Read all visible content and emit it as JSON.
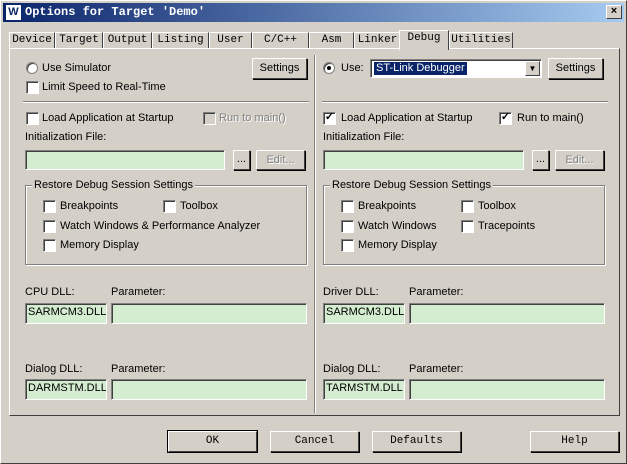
{
  "window": {
    "title": "Options for Target 'Demo'",
    "close_glyph": "×",
    "icon_glyph": "W"
  },
  "tabs": [
    {
      "label": "Device"
    },
    {
      "label": "Target"
    },
    {
      "label": "Output"
    },
    {
      "label": "Listing"
    },
    {
      "label": "User"
    },
    {
      "label": "C/C++"
    },
    {
      "label": "Asm"
    },
    {
      "label": "Linker"
    },
    {
      "label": "Debug"
    },
    {
      "label": "Utilities"
    }
  ],
  "active_tab": "Debug",
  "left": {
    "use_label": "Use Simulator",
    "use_selected": false,
    "limit_speed_label": "Limit Speed to Real-Time",
    "limit_speed_checked": false,
    "settings_label": "Settings",
    "load_app_label": "Load Application at Startup",
    "load_app_checked": false,
    "run_to_main_label": "Run to main()",
    "run_to_main_checked": false,
    "init_file_label": "Initialization File:",
    "init_file_value": "",
    "browse_label": "...",
    "edit_label": "Edit...",
    "restore_title": "Restore Debug Session Settings",
    "restore": {
      "breakpoints": "Breakpoints",
      "toolbox": "Toolbox",
      "watch": "Watch Windows & Performance Analyzer",
      "memory": "Memory Display"
    },
    "cpu_dll_label": "CPU DLL:",
    "cpu_dll_value": "SARMCM3.DLL",
    "cpu_param_label": "Parameter:",
    "cpu_param_value": "",
    "dialog_dll_label": "Dialog DLL:",
    "dialog_dll_value": "DARMSTM.DLL",
    "dialog_param_label": "Parameter:",
    "dialog_param_value": ""
  },
  "right": {
    "use_label": "Use:",
    "use_selected": true,
    "debugger_value": "ST-Link Debugger",
    "settings_label": "Settings",
    "load_app_label": "Load Application at Startup",
    "load_app_checked": true,
    "run_to_main_label": "Run to main()",
    "run_to_main_checked": true,
    "init_file_label": "Initialization File:",
    "init_file_value": "",
    "browse_label": "...",
    "edit_label": "Edit...",
    "restore_title": "Restore Debug Session Settings",
    "restore": {
      "breakpoints": "Breakpoints",
      "toolbox": "Toolbox",
      "watch": "Watch Windows",
      "tracepoints": "Tracepoints",
      "memory": "Memory Display"
    },
    "driver_dll_label": "Driver DLL:",
    "driver_dll_value": "SARMCM3.DLL",
    "driver_param_label": "Parameter:",
    "driver_param_value": "",
    "dialog_dll_label": "Dialog DLL:",
    "dialog_dll_value": "TARMSTM.DLL",
    "dialog_param_label": "Parameter:",
    "dialog_param_value": ""
  },
  "footer": {
    "ok": "OK",
    "cancel": "Cancel",
    "defaults": "Defaults",
    "help": "Help"
  },
  "check_glyph": "✓",
  "arrow_glyph": "▼"
}
